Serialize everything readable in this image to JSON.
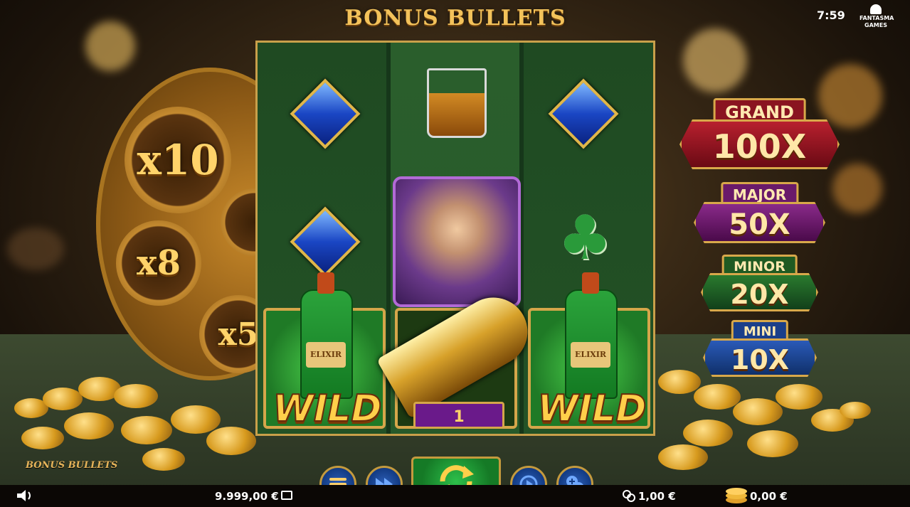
{
  "header": {
    "title": "BONUS BULLETS",
    "clock": "7:59",
    "provider_logo_text": "FANTASMA GAMES"
  },
  "cylinder": {
    "multipliers": [
      "x10",
      "x8",
      "x5"
    ]
  },
  "reels": {
    "col1": [
      "blue-diamond",
      "blue-diamond",
      "wild-elixir"
    ],
    "col2": [
      "whiskey-glass",
      "lady-portrait",
      "bonus-bullet"
    ],
    "col3": [
      "blue-diamond",
      "green-club",
      "wild-elixir"
    ],
    "wild_label": "WILD",
    "bottle_label": "ELIXIR",
    "bullet_count": "1"
  },
  "jackpots": [
    {
      "name": "GRAND",
      "value": "100X",
      "color": "#8a1420"
    },
    {
      "name": "MAJOR",
      "value": "50X",
      "color": "#6a1a6a"
    },
    {
      "name": "MINOR",
      "value": "20X",
      "color": "#1f5a22"
    },
    {
      "name": "MINI",
      "value": "10X",
      "color": "#1a3f8a"
    }
  ],
  "footer": {
    "game_name": "BONUS BULLETS",
    "balance": "9.999,00 €",
    "bet": "1,00 €",
    "win": "0,00 €"
  },
  "icons": [
    "speaker-icon",
    "wallet-icon",
    "menu-icon",
    "fast-forward-icon",
    "spin-icon",
    "autoplay-icon",
    "bet-adjust-icon",
    "coins-icon",
    "stack-coins-icon"
  ]
}
